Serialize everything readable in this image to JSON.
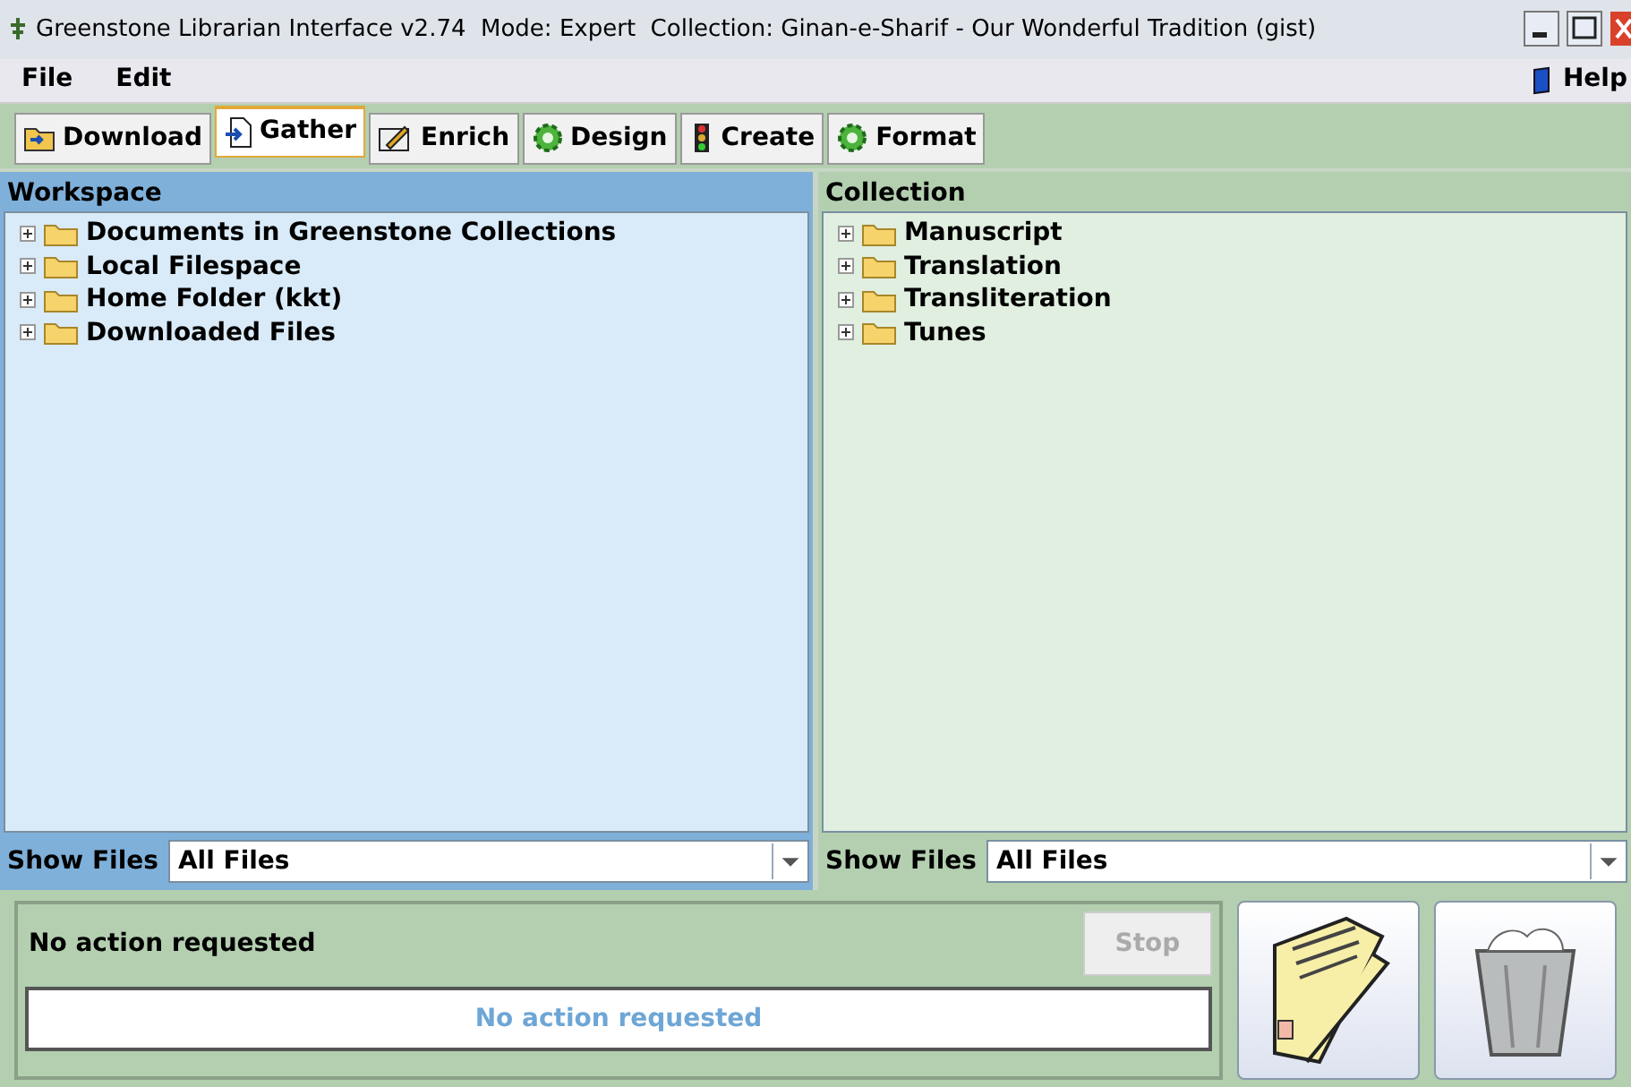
{
  "window": {
    "title": "Greenstone Librarian Interface v2.74  Mode: Expert  Collection: Ginan-e-Sharif - Our Wonderful Tradition (gist)"
  },
  "menu": [
    "File",
    "Edit"
  ],
  "help": "Help",
  "tabs": [
    {
      "label": "Download",
      "selected": false
    },
    {
      "label": "Gather",
      "selected": true
    },
    {
      "label": "Enrich",
      "selected": false
    },
    {
      "label": "Design",
      "selected": false
    },
    {
      "label": "Create",
      "selected": false
    },
    {
      "label": "Format",
      "selected": false
    }
  ],
  "workspace": {
    "title": "Workspace",
    "items": [
      {
        "label": "Documents in Greenstone Collections",
        "expanded": false
      },
      {
        "label": "Local Filespace",
        "expanded": false
      },
      {
        "label": "Home Folder (kkt)",
        "expanded": false
      },
      {
        "label": "Downloaded Files",
        "expanded": false
      }
    ],
    "filter_label": "Show Files",
    "filter": "All Files"
  },
  "collection": {
    "title": "Collection",
    "items": [
      {
        "label": "Manuscript",
        "expanded": false
      },
      {
        "label": "Translation",
        "expanded": false
      },
      {
        "label": "Transliteration",
        "expanded": false
      },
      {
        "label": "Tunes",
        "expanded": false
      }
    ],
    "filter_label": "Show Files",
    "filter": "All Files"
  },
  "status": {
    "message": "No action requested",
    "stop": {
      "label": "Stop",
      "disabled": true
    },
    "progress": "No action requested"
  }
}
